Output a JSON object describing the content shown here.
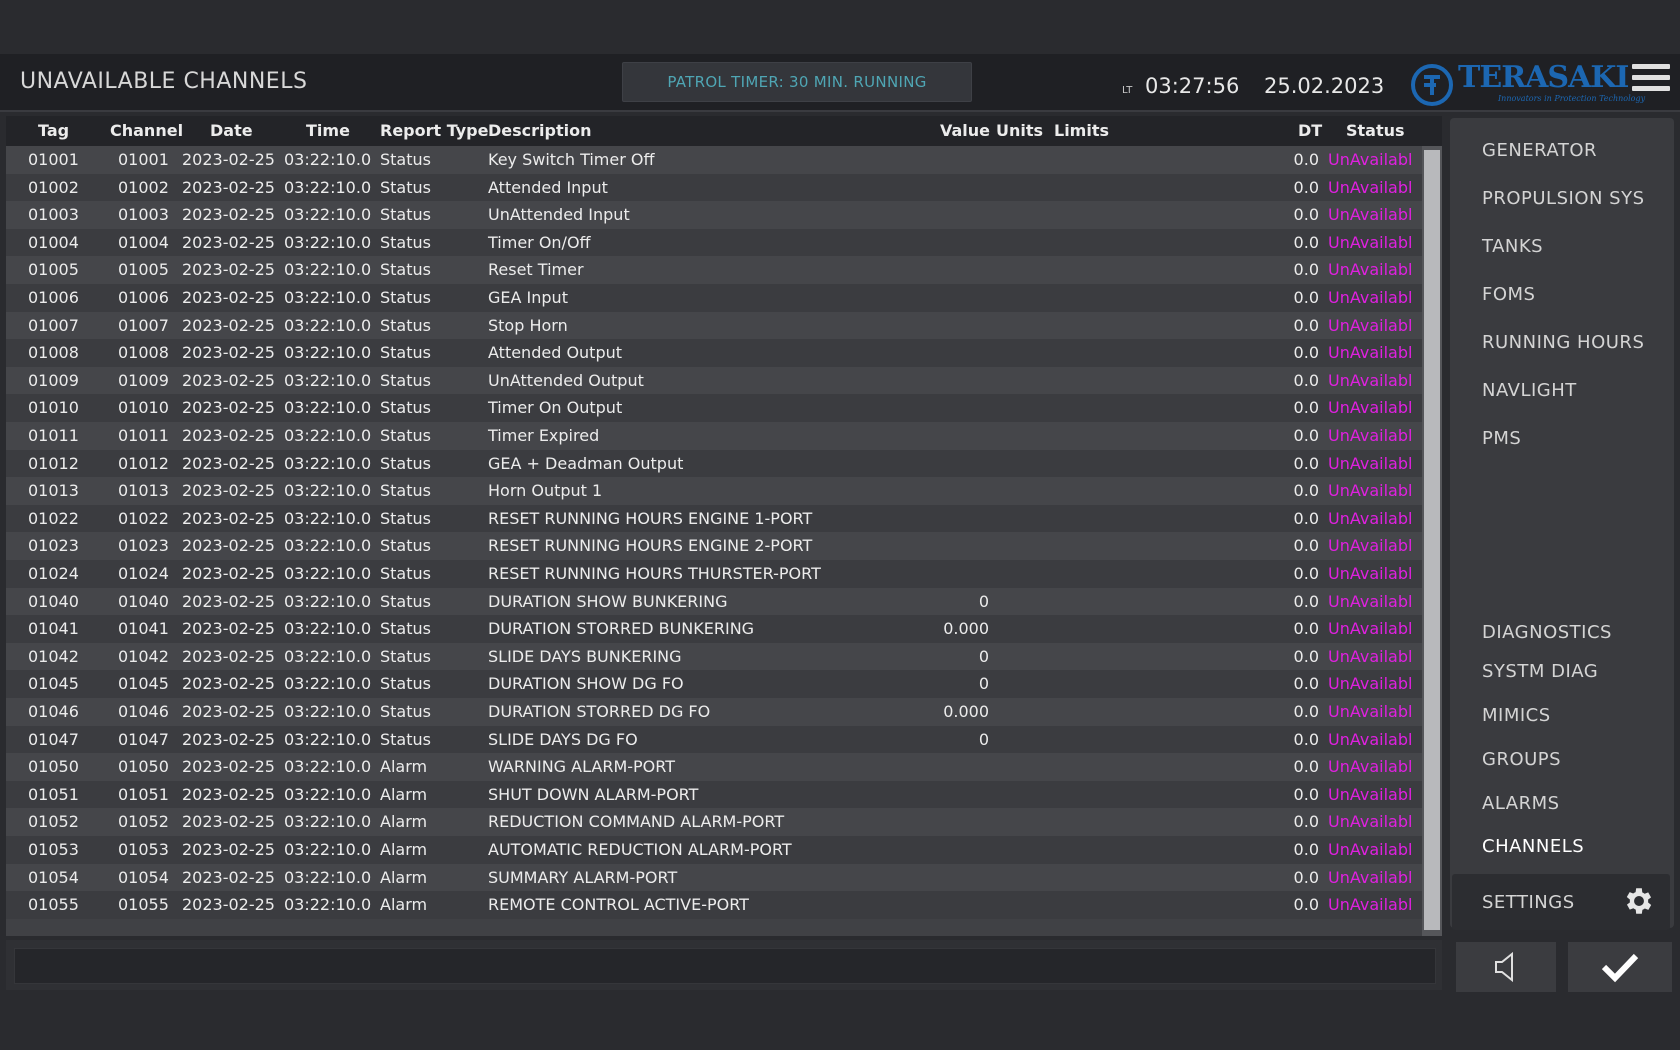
{
  "header": {
    "title": "UNAVAILABLE CHANNELS",
    "patrol_timer": "PATROL TIMER: 30 MIN. RUNNING",
    "lt_label": "LT",
    "time": "03:27:56",
    "date": "25.02.2023",
    "logo_text": "TERASAKI",
    "logo_sub": "Innovators in Protection Technology",
    "menu_icon": "hamburger-icon"
  },
  "table": {
    "columns": [
      "Tag",
      "Channel",
      "Date",
      "Time",
      "Report Type",
      "Description",
      "Value",
      "Units",
      "Limits",
      "DT",
      "Status"
    ],
    "rows": [
      [
        "01001",
        "01001",
        "2023-02-25",
        "03:22:10.0",
        "Status",
        "Key Switch Timer Off",
        "",
        "",
        "",
        "0.0",
        "UnAvailabl"
      ],
      [
        "01002",
        "01002",
        "2023-02-25",
        "03:22:10.0",
        "Status",
        "Attended Input",
        "",
        "",
        "",
        "0.0",
        "UnAvailabl"
      ],
      [
        "01003",
        "01003",
        "2023-02-25",
        "03:22:10.0",
        "Status",
        "UnAttended Input",
        "",
        "",
        "",
        "0.0",
        "UnAvailabl"
      ],
      [
        "01004",
        "01004",
        "2023-02-25",
        "03:22:10.0",
        "Status",
        "Timer On/Off",
        "",
        "",
        "",
        "0.0",
        "UnAvailabl"
      ],
      [
        "01005",
        "01005",
        "2023-02-25",
        "03:22:10.0",
        "Status",
        "Reset Timer",
        "",
        "",
        "",
        "0.0",
        "UnAvailabl"
      ],
      [
        "01006",
        "01006",
        "2023-02-25",
        "03:22:10.0",
        "Status",
        "GEA Input",
        "",
        "",
        "",
        "0.0",
        "UnAvailabl"
      ],
      [
        "01007",
        "01007",
        "2023-02-25",
        "03:22:10.0",
        "Status",
        "Stop Horn",
        "",
        "",
        "",
        "0.0",
        "UnAvailabl"
      ],
      [
        "01008",
        "01008",
        "2023-02-25",
        "03:22:10.0",
        "Status",
        "Attended Output",
        "",
        "",
        "",
        "0.0",
        "UnAvailabl"
      ],
      [
        "01009",
        "01009",
        "2023-02-25",
        "03:22:10.0",
        "Status",
        "UnAttended Output",
        "",
        "",
        "",
        "0.0",
        "UnAvailabl"
      ],
      [
        "01010",
        "01010",
        "2023-02-25",
        "03:22:10.0",
        "Status",
        "Timer On Output",
        "",
        "",
        "",
        "0.0",
        "UnAvailabl"
      ],
      [
        "01011",
        "01011",
        "2023-02-25",
        "03:22:10.0",
        "Status",
        "Timer Expired",
        "",
        "",
        "",
        "0.0",
        "UnAvailabl"
      ],
      [
        "01012",
        "01012",
        "2023-02-25",
        "03:22:10.0",
        "Status",
        "GEA + Deadman Output",
        "",
        "",
        "",
        "0.0",
        "UnAvailabl"
      ],
      [
        "01013",
        "01013",
        "2023-02-25",
        "03:22:10.0",
        "Status",
        "Horn Output 1",
        "",
        "",
        "",
        "0.0",
        "UnAvailabl"
      ],
      [
        "01022",
        "01022",
        "2023-02-25",
        "03:22:10.0",
        "Status",
        "RESET RUNNING HOURS ENGINE 1-PORT",
        "",
        "",
        "",
        "0.0",
        "UnAvailabl"
      ],
      [
        "01023",
        "01023",
        "2023-02-25",
        "03:22:10.0",
        "Status",
        "RESET RUNNING HOURS ENGINE 2-PORT",
        "",
        "",
        "",
        "0.0",
        "UnAvailabl"
      ],
      [
        "01024",
        "01024",
        "2023-02-25",
        "03:22:10.0",
        "Status",
        "RESET RUNNING HOURS THURSTER-PORT",
        "",
        "",
        "",
        "0.0",
        "UnAvailabl"
      ],
      [
        "01040",
        "01040",
        "2023-02-25",
        "03:22:10.0",
        "Status",
        "DURATION SHOW BUNKERING",
        "0",
        "",
        "",
        "0.0",
        "UnAvailabl"
      ],
      [
        "01041",
        "01041",
        "2023-02-25",
        "03:22:10.0",
        "Status",
        "DURATION STORRED BUNKERING",
        "0.000",
        "",
        "",
        "0.0",
        "UnAvailabl"
      ],
      [
        "01042",
        "01042",
        "2023-02-25",
        "03:22:10.0",
        "Status",
        "SLIDE DAYS BUNKERING",
        "0",
        "",
        "",
        "0.0",
        "UnAvailabl"
      ],
      [
        "01045",
        "01045",
        "2023-02-25",
        "03:22:10.0",
        "Status",
        "DURATION SHOW DG FO",
        "0",
        "",
        "",
        "0.0",
        "UnAvailabl"
      ],
      [
        "01046",
        "01046",
        "2023-02-25",
        "03:22:10.0",
        "Status",
        "DURATION STORRED DG FO",
        "0.000",
        "",
        "",
        "0.0",
        "UnAvailabl"
      ],
      [
        "01047",
        "01047",
        "2023-02-25",
        "03:22:10.0",
        "Status",
        "SLIDE DAYS DG FO",
        "0",
        "",
        "",
        "0.0",
        "UnAvailabl"
      ],
      [
        "01050",
        "01050",
        "2023-02-25",
        "03:22:10.0",
        "Alarm",
        "WARNING ALARM-PORT",
        "",
        "",
        "",
        "0.0",
        "UnAvailabl"
      ],
      [
        "01051",
        "01051",
        "2023-02-25",
        "03:22:10.0",
        "Alarm",
        "SHUT DOWN ALARM-PORT",
        "",
        "",
        "",
        "0.0",
        "UnAvailabl"
      ],
      [
        "01052",
        "01052",
        "2023-02-25",
        "03:22:10.0",
        "Alarm",
        "REDUCTION COMMAND ALARM-PORT",
        "",
        "",
        "",
        "0.0",
        "UnAvailabl"
      ],
      [
        "01053",
        "01053",
        "2023-02-25",
        "03:22:10.0",
        "Alarm",
        "AUTOMATIC REDUCTION ALARM-PORT",
        "",
        "",
        "",
        "0.0",
        "UnAvailabl"
      ],
      [
        "01054",
        "01054",
        "2023-02-25",
        "03:22:10.0",
        "Alarm",
        "SUMMARY ALARM-PORT",
        "",
        "",
        "",
        "0.0",
        "UnAvailabl"
      ],
      [
        "01055",
        "01055",
        "2023-02-25",
        "03:22:10.0",
        "Alarm",
        "REMOTE CONTROL ACTIVE-PORT",
        "",
        "",
        "",
        "0.0",
        "UnAvailabl"
      ]
    ]
  },
  "sidebar": {
    "top_items": [
      "GENERATOR",
      "PROPULSION SYS",
      "TANKS",
      "FOMS",
      "RUNNING HOURS",
      "NAVLIGHT",
      "PMS"
    ],
    "bottom_items": [
      "DIAGNOSTICS",
      "SYSTM DIAG",
      "MIMICS",
      "GROUPS",
      "ALARMS",
      "CHANNELS"
    ],
    "active": "CHANNELS",
    "settings_label": "SETTINGS",
    "settings_icon": "gear-icon"
  },
  "footer": {
    "input_value": "",
    "sound_icon": "speaker-icon",
    "ack_icon": "checkmark-icon"
  },
  "colors": {
    "status_unavailable": "#e020e0",
    "patrol_text": "#4fa6b4",
    "logo_blue": "#1c67b2"
  }
}
